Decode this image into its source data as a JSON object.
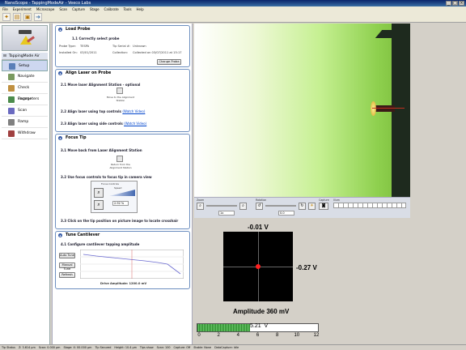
{
  "window": {
    "title": "NanoScope - TappingModeAir - Veeco Labs"
  },
  "menu": [
    "File",
    "Experiment",
    "Microscope",
    "Scan",
    "Capture",
    "Stage",
    "Calibrate",
    "Tools",
    "Help"
  ],
  "sidebar": {
    "mode": "TappingMode Air",
    "items": [
      {
        "label": "Setup",
        "active": true
      },
      {
        "label": "Navigate"
      },
      {
        "label": "Check Parameters"
      },
      {
        "label": "Engage"
      },
      {
        "label": "Scan"
      },
      {
        "label": "Ramp"
      },
      {
        "label": "Withdraw"
      }
    ]
  },
  "workflow": {
    "load_probe": {
      "title": "Load Probe",
      "step": "1.1 Correctly select probe",
      "probe_type_label": "Probe Type:",
      "probe_type": "TESPA",
      "tip_serial_label": "Tip Serial #:",
      "tip_serial": "Unknown",
      "installed_label": "Installed On:",
      "installed": "03/01/2011",
      "collection_label": "Collection:",
      "collection": "Collected on 03/07/2011 at 15:17",
      "change_probe": "Change Probe"
    },
    "align_laser": {
      "title": "Align Laser on Probe",
      "step1": "2.1 Move laser Alignment Station - optional",
      "station_label": "Move to the Alignment Station",
      "step2_prefix": "2.2 Align laser using top controls",
      "step2_link": "(Watch Video)",
      "step3_prefix": "2.3 Align laser using side controls",
      "step3_link": "(Watch Video)"
    },
    "focus_tip": {
      "title": "Focus Tip",
      "step1": "3.1 Move back from Laser Alignment Station",
      "return_label": "Return from the Alignment Station",
      "step2": "3.2 Use focus controls to focus tip in camera view",
      "focus_control": "Focus Controls",
      "speed_label": "Speed",
      "speed_value": "2.92 %",
      "step3": "3.3 Click on the tip position on picture image to locate crosshair"
    },
    "tune": {
      "title": "Tune Cantilever",
      "step1": "4.1 Configure cantilever tapping amplitude",
      "auto_tune": "Auto Tune",
      "manual_tune": "Manual Tune",
      "refresh": "Refresh",
      "drive_amp": "Drive Amplitude: 1200.0 mV"
    }
  },
  "camera": {
    "zoom_label": "Zoom",
    "zoom_value": "1x",
    "rotation_label": "Rotation",
    "rotation_value": "0.0",
    "capture_label": "Capture",
    "illum_label": "Illum"
  },
  "detector": {
    "vertical": "-0.01 V",
    "horizontal": "-0.27 V",
    "amplitude": "Amplitude 360 mV",
    "sum_value": "5.21",
    "sum_unit": "V",
    "sum_fraction": 0.434,
    "ticks": [
      "0",
      "2",
      "4",
      "6",
      "8",
      "10",
      "12"
    ]
  },
  "status": [
    "Tip Status",
    "Z: 3.614 µm",
    "Scan: 0.000 µm",
    "Stage: X: 00.000 µm",
    "Tip Secured",
    "Height: 10.4 µm",
    "Tips show",
    "Scan: 100",
    "Capture: Off",
    "Stable: None",
    "DataCapture: Idle"
  ]
}
